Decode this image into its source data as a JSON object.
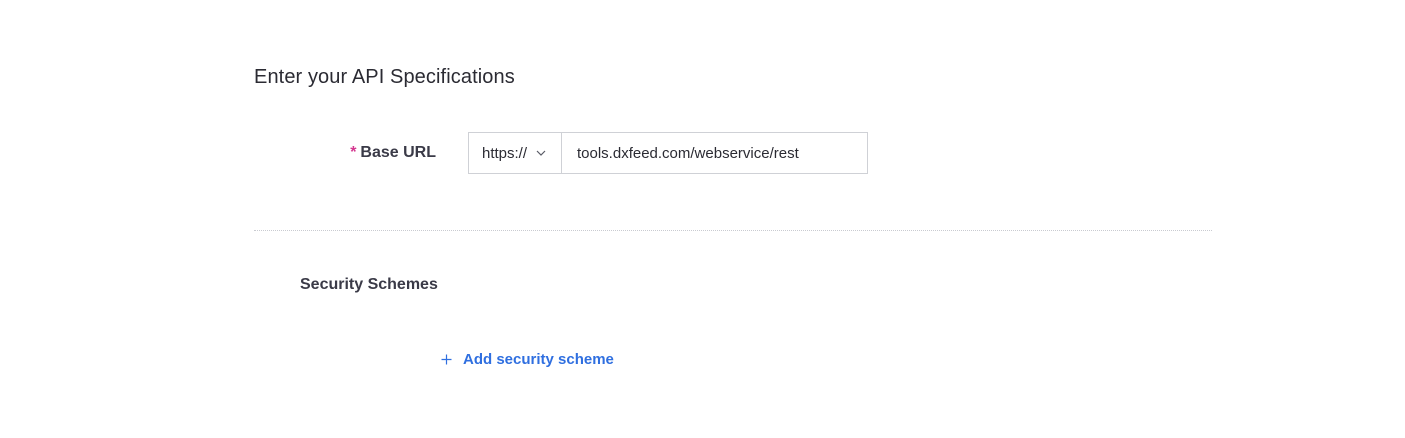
{
  "section": {
    "title": "Enter your API Specifications"
  },
  "base_url": {
    "required_mark": "*",
    "label": "Base URL",
    "scheme_selected": "https://",
    "value": "tools.dxfeed.com/webservice/rest"
  },
  "security": {
    "label": "Security Schemes",
    "add_label": "Add security scheme"
  },
  "icons": {
    "scheme_dropdown": "chevron-down-icon",
    "add": "plus-icon"
  },
  "colors": {
    "required": "#d4378f",
    "link": "#2f6fe0",
    "text": "#2b2b33",
    "border": "#cfd1d6"
  }
}
